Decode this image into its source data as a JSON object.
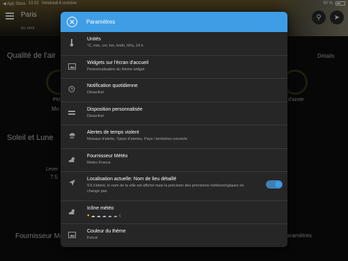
{
  "status_bar": {
    "app": "◀ App Store",
    "time": "13:32",
    "date": "Vendredi 6 octobre",
    "battery": "50 %"
  },
  "background": {
    "city": "Paris",
    "wind": "du vent",
    "air_quality": "Qualité de l'air",
    "details": "Détails",
    "pm": "PM",
    "mod": "Mo",
    "azote": "d'azote",
    "sun_moon": "Soleil et Lune",
    "lever": "Lever",
    "time75": "7:5",
    "provider": "Fournisseur Mété",
    "params": "aramètres"
  },
  "modal": {
    "title": "Paramètres",
    "items": [
      {
        "title": "Unités",
        "sub": "°C, mm, cm, km, km/h, hPa, 24 h",
        "icon": "thermometer-icon"
      },
      {
        "title": "Widgets sur l'écran d'accueil",
        "sub": "Personnalisation du thème widget",
        "icon": "image-icon"
      },
      {
        "title": "Notification quotidienne",
        "sub": "Désactivé",
        "icon": "clock-icon"
      },
      {
        "title": "Disposition personnalisée",
        "sub": "Désactivé",
        "icon": "layout-icon"
      },
      {
        "title": "Alertes de temps violent",
        "sub": "Niveaux d'alerte, Types d'alertes, Pays / territoires couverts",
        "icon": "storm-icon"
      },
      {
        "title": "Fournisseur Météo",
        "sub": "Meteo France",
        "icon": "cloud-sun-icon"
      },
      {
        "title": "Localisation actuelle: Nom de lieu détaillé",
        "sub": "S'il s'éteint, le nom de la ville est affiché mais la précision des prévisions météorologiques ne change pas.",
        "icon": "location-arrow-icon"
      },
      {
        "title": "Icône météo",
        "sub": "",
        "icon": "cloud-sun-icon"
      },
      {
        "title": "Couleur du thème",
        "sub": "Foncé",
        "icon": "image-icon"
      }
    ],
    "location_toggle": true
  }
}
